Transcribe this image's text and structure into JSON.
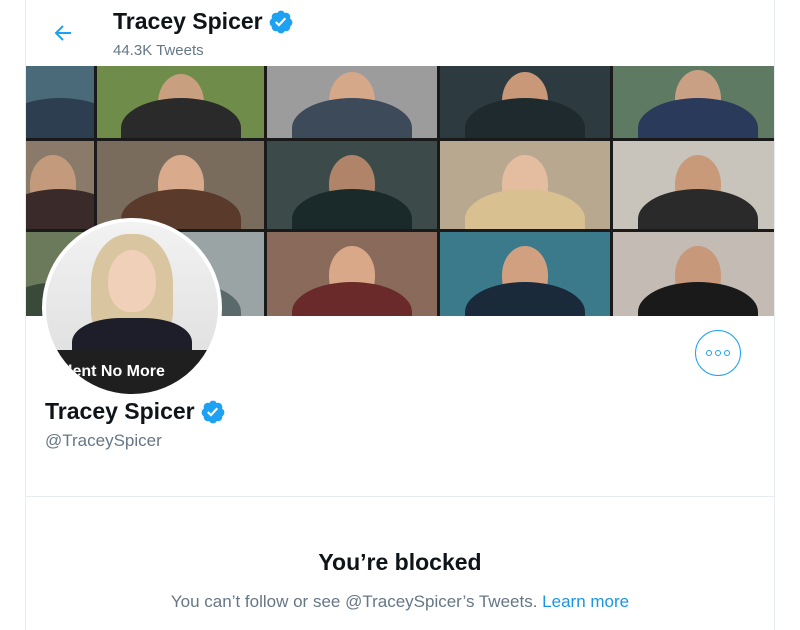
{
  "header": {
    "name": "Tracey Spicer",
    "tweet_count": "44.3K Tweets",
    "back_icon": "arrow-left-icon"
  },
  "banner": {
    "alt": "Grid of video-call faces"
  },
  "avatar": {
    "caption": "lent No More"
  },
  "profile": {
    "name": "Tracey Spicer",
    "handle": "@TraceySpicer",
    "verified_icon": "verified-badge-icon",
    "more_icon": "more-options-icon"
  },
  "blocked": {
    "title": "You’re blocked",
    "message": "You can’t follow or see @TraceySpicer’s Tweets.",
    "link": "Learn more"
  },
  "colors": {
    "accent": "#1da1f2",
    "secondary_text": "#657786",
    "primary_text": "#0f1419",
    "border": "#e6ecf0"
  }
}
